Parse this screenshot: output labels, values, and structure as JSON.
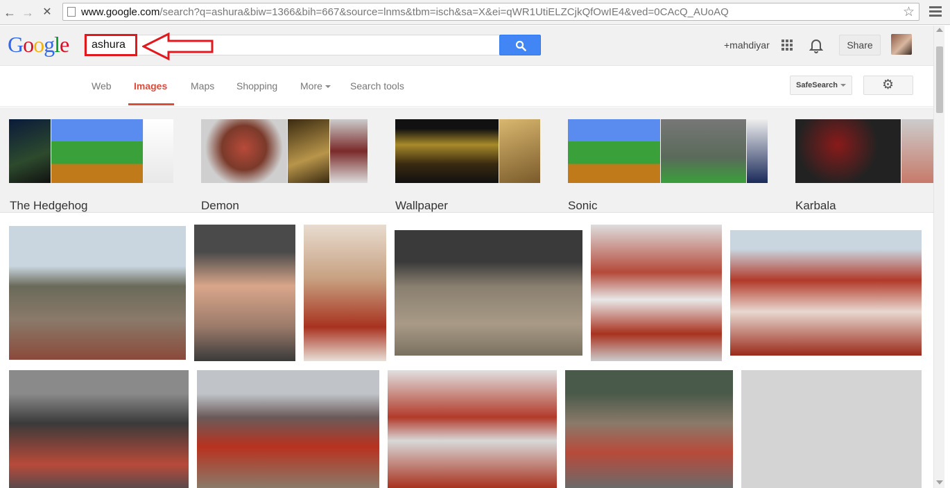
{
  "browser": {
    "url_host": "www.google.com",
    "url_rest": "/search?q=ashura&biw=1366&bih=667&source=lnms&tbm=isch&sa=X&ei=qWR1UtiELZCjkQfOwIE4&ved=0CAcQ_AUoAQ",
    "icons": [
      "back-arrow-icon",
      "forward-arrow-icon",
      "stop-icon",
      "page-icon",
      "bookmark-star-icon",
      "hamburger-menu-icon"
    ]
  },
  "header": {
    "logo": "Google",
    "logo_colors": [
      "#3369e8",
      "#d50f25",
      "#eeb211",
      "#3369e8",
      "#009925",
      "#d50f25"
    ],
    "query": "ashura",
    "highlight_color": "#e0191f",
    "user": "+mahdiyar",
    "share_label": "Share"
  },
  "tabs": {
    "items": [
      "Web",
      "Images",
      "Maps",
      "Shopping",
      "More",
      "Search tools"
    ],
    "active": "Images",
    "safesearch_label": "SafeSearch"
  },
  "related": [
    {
      "label": "The Hedgehog"
    },
    {
      "label": "Demon"
    },
    {
      "label": "Wallpaper"
    },
    {
      "label": "Sonic"
    },
    {
      "label": "Karbala"
    }
  ],
  "results": {
    "count_visible": 11,
    "descriptions": []
  }
}
